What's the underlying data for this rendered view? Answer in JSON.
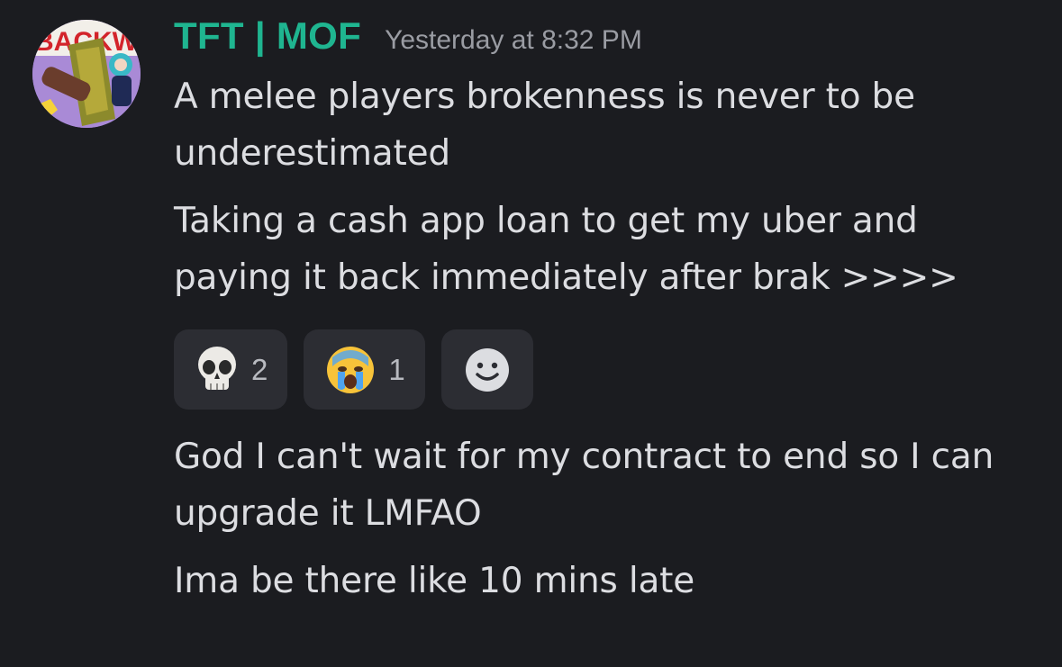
{
  "author": {
    "username": "TFT | MOF",
    "timestamp": "Yesterday at 8:32 PM",
    "avatar_icon": "avatar-image",
    "avatar_text": "BACKWO"
  },
  "messages_before_reactions": [
    {
      "lines": [
        "A melee players brokenness is never to be",
        "underestimated"
      ]
    },
    {
      "lines": [
        "Taking a cash app loan to get my uber and",
        "paying it back immediately after brak >>>>"
      ]
    }
  ],
  "reactions": [
    {
      "emoji": "skull-emoji",
      "count": "2"
    },
    {
      "emoji": "crying-face-emoji",
      "count": "1"
    }
  ],
  "add_reaction_icon": "add-reaction-smiley-icon",
  "messages_after_reactions": [
    {
      "lines": [
        "God I can't wait for my contract to end so I can",
        "upgrade it LMFAO"
      ]
    },
    {
      "lines": [
        "Ima be there like 10 mins late"
      ]
    }
  ],
  "colors": {
    "background": "#1b1c20",
    "username": "#1fb590",
    "timestamp": "#9a9ca3",
    "text": "#dcdde1",
    "reaction_bg": "#2c2d33"
  }
}
